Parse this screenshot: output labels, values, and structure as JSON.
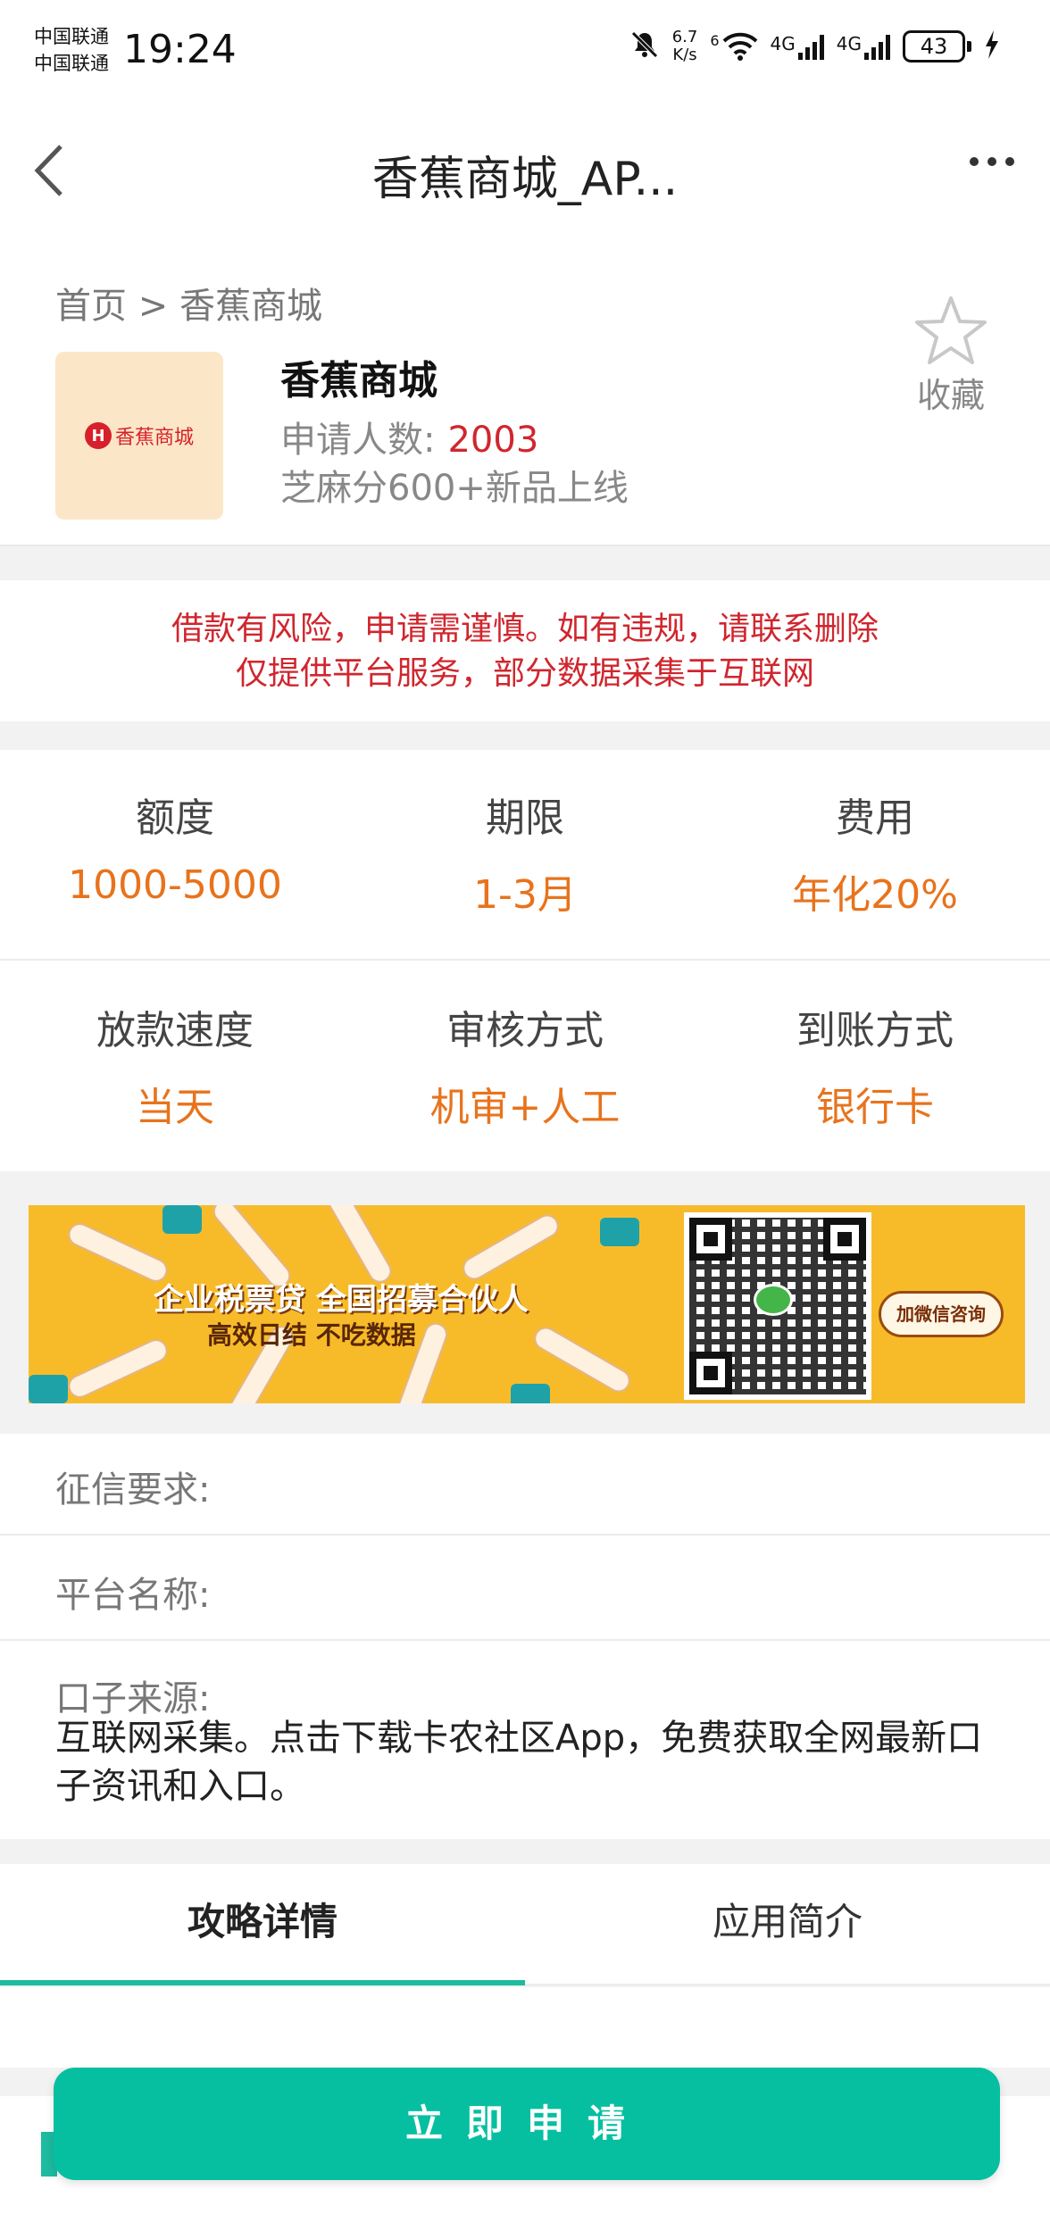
{
  "status_bar": {
    "carrier_1": "中国联通",
    "carrier_2": "中国联通",
    "time": "19:24",
    "speed_value": "6.7",
    "speed_unit": "K/s",
    "wifi_badge": "6",
    "net_1": "4G",
    "net_2": "4G",
    "battery": "43"
  },
  "navbar": {
    "title": "香蕉商城_AP..."
  },
  "product": {
    "breadcrumb": "首页 > 香蕉商城",
    "name": "香蕉商城",
    "applicants_label": "申请人数:",
    "applicants_count": "2003",
    "tagline": "芝麻分600+新品上线",
    "favorite_label": "收藏",
    "logo_text": "香蕉商城"
  },
  "notice": {
    "line1": "借款有风险，申请需谨慎。如有违规，请联系删除",
    "line2": "仅提供平台服务，部分数据采集于互联网"
  },
  "stats": {
    "row1": [
      {
        "label": "额度",
        "value": "1000-5000"
      },
      {
        "label": "期限",
        "value": "1-3月"
      },
      {
        "label": "费用",
        "value": "年化20%"
      }
    ],
    "row2": [
      {
        "label": "放款速度",
        "value": "当天"
      },
      {
        "label": "审核方式",
        "value": "机审+人工"
      },
      {
        "label": "到账方式",
        "value": "银行卡"
      }
    ]
  },
  "banner": {
    "title": "企业税票贷 全国招募合伙人",
    "subtitle": "高效日结 不吃数据",
    "button": "加微信咨询"
  },
  "info": {
    "credit_label": "征信要求:",
    "platform_label": "平台名称:",
    "source_label": "口子来源:",
    "source_text": "互联网采集。点击下载卡农社区App，免费获取全网最新口子资讯和入口。"
  },
  "tabs": [
    {
      "label": "攻略详情",
      "active": true
    },
    {
      "label": "应用简介",
      "active": false
    }
  ],
  "apply_button": "立即申请",
  "colors": {
    "accent": "#06bfa1",
    "orange": "#e8731c",
    "red": "#d0262e"
  }
}
